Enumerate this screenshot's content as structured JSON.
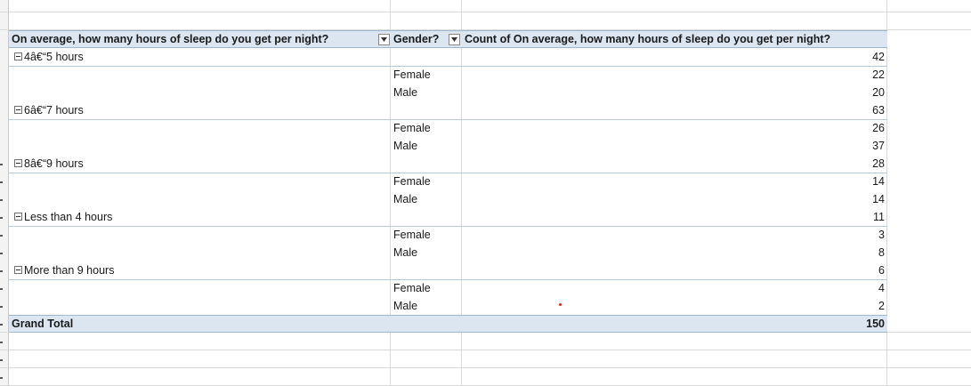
{
  "pivot": {
    "headers": {
      "row_field": "On average, how many hours of sleep do you get per night?",
      "col_field": "Gender?",
      "value_field": "Count of On average, how many hours of sleep do you get per night?"
    },
    "groups": [
      {
        "label": "4â€“5 hours",
        "total": "42",
        "rows": [
          {
            "gender": "Female",
            "count": "22"
          },
          {
            "gender": "Male",
            "count": "20"
          }
        ]
      },
      {
        "label": "6â€“7 hours",
        "total": "63",
        "rows": [
          {
            "gender": "Female",
            "count": "26"
          },
          {
            "gender": "Male",
            "count": "37"
          }
        ]
      },
      {
        "label": "8â€“9 hours",
        "total": "28",
        "rows": [
          {
            "gender": "Female",
            "count": "14"
          },
          {
            "gender": "Male",
            "count": "14"
          }
        ]
      },
      {
        "label": "Less than 4 hours",
        "total": "11",
        "rows": [
          {
            "gender": "Female",
            "count": "3"
          },
          {
            "gender": "Male",
            "count": "8"
          }
        ]
      },
      {
        "label": "More than 9 hours",
        "total": "6",
        "rows": [
          {
            "gender": "Female",
            "count": "4"
          },
          {
            "gender": "Male",
            "count": "2"
          }
        ]
      }
    ],
    "grand_total": {
      "label": "Grand Total",
      "value": "150"
    }
  },
  "icons": {
    "filter_dropdown": "chevron-down-icon",
    "collapse": "minus-box-icon"
  },
  "colors": {
    "header_band": "#dce6f1",
    "grid": "#dadada",
    "marker": "#d9261c"
  }
}
